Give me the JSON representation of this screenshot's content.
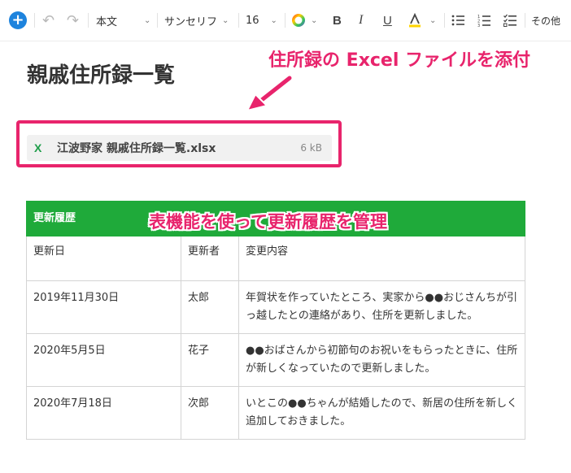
{
  "toolbar": {
    "paragraph_style": "本文",
    "font_family": "サンセリフ",
    "font_size": "16",
    "more_label": "その他"
  },
  "document": {
    "title": "親戚住所録一覧"
  },
  "attachment": {
    "file_name": "江波野家 親戚住所録一覧.xlsx",
    "file_size": "6 kB",
    "icon_glyph": "X"
  },
  "annotations": {
    "attachment_note": "住所録の Excel ファイルを添付",
    "table_note": "表機能を使って更新履歴を管理"
  },
  "table": {
    "title": "更新履歴",
    "columns": [
      "更新日",
      "更新者",
      "変更内容"
    ],
    "rows": [
      {
        "date": "2019年11月30日",
        "author": "太郎",
        "change": "年賀状を作っていたところ、実家から●●おじさんちが引っ越したとの連絡があり、住所を更新しました。"
      },
      {
        "date": "2020年5月5日",
        "author": "花子",
        "change": "●●おばさんから初節句のお祝いをもらったときに、住所が新しくなっていたので更新しました。"
      },
      {
        "date": "2020年7月18日",
        "author": "次郎",
        "change": "いとこの●●ちゃんが結婚したので、新居の住所を新しく追加しておきました。"
      }
    ]
  },
  "colors": {
    "accent_blue": "#1d83dd",
    "annotation_pink": "#e8246c",
    "table_header_green": "#1faa3a",
    "excel_green": "#1f9d4a"
  }
}
